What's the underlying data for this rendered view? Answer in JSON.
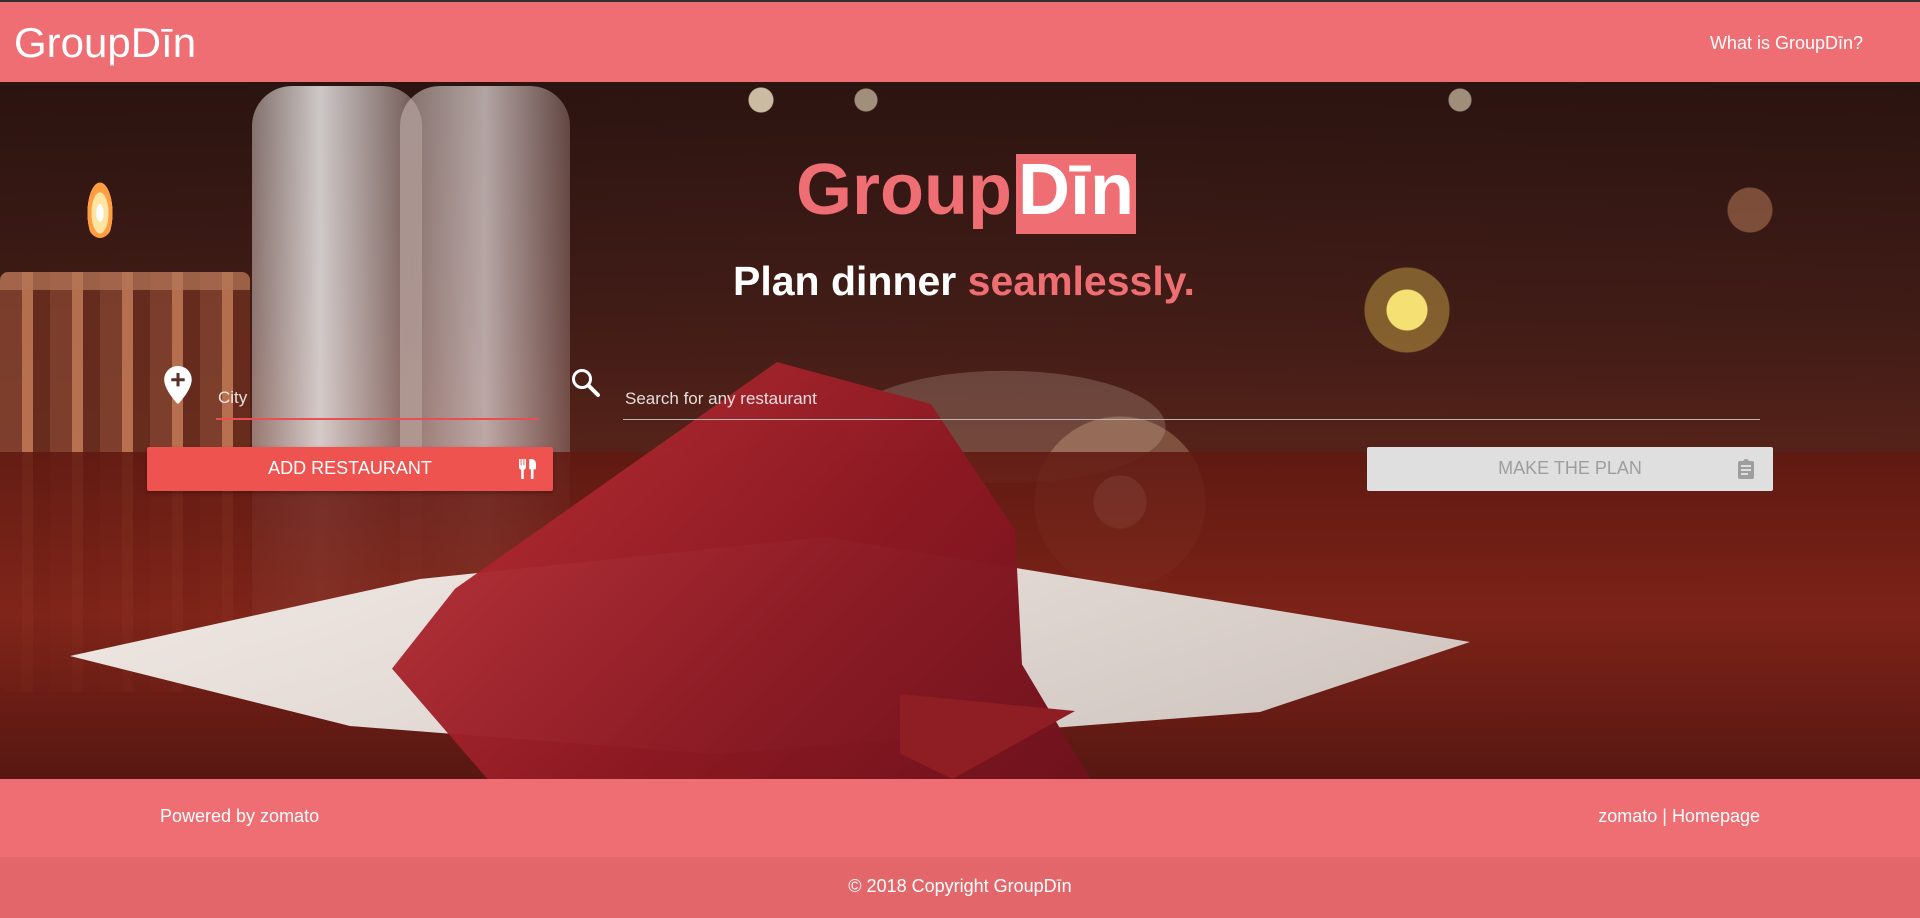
{
  "header": {
    "brand": "GroupDīn",
    "nav_link": "What is GroupDīn?"
  },
  "hero": {
    "brand_main": "Group",
    "brand_highlight": "Dīn",
    "tagline_main": "Plan dinner ",
    "tagline_accent": "seamlessly."
  },
  "search": {
    "city_placeholder": "City",
    "restaurant_placeholder": "Search for any restaurant",
    "city_icon": "location-pin-plus-icon",
    "search_icon": "search-icon"
  },
  "actions": {
    "add_label": "ADD RESTAURANT",
    "add_icon": "fork-knife-icon",
    "plan_label": "MAKE THE PLAN",
    "plan_icon": "clipboard-icon"
  },
  "footer": {
    "powered": "Powered by zomato",
    "zomato_link": "zomato",
    "separator": "|",
    "homepage_link": "Homepage",
    "copyright": "© 2018 Copyright GroupDīn"
  },
  "colors": {
    "brand_pink": "#ee6e73",
    "accent_red": "#ef5350",
    "disabled_gray": "#dfdfdf",
    "white": "#ffffff"
  }
}
